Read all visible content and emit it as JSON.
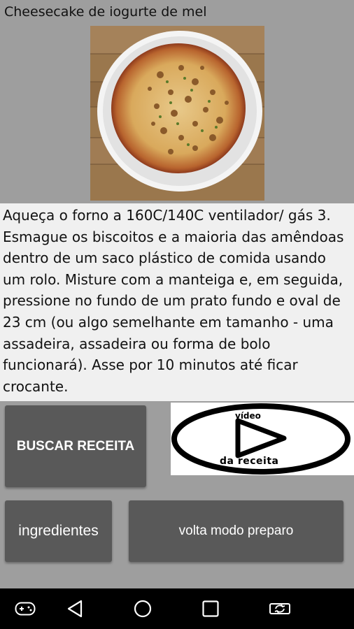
{
  "recipe": {
    "title": "Cheesecake de iogurte de mel",
    "description": "Aqueça o forno a 160C/140C ventilador/ gás 3. Esmague os biscoitos e a maioria das amêndoas dentro de um saco plástico de comida usando um rolo. Misture com a manteiga e, em seguida, pressione no fundo de um prato fundo e oval de 23 cm (ou algo semelhante em tamanho - uma assadeira, assadeira ou forma de bolo funcionará). Asse por 10 minutos até ficar crocante."
  },
  "buttons": {
    "search": "BUSCAR RECEITA",
    "ingredients": "ingredientes",
    "back_to_preparation": "volta modo preparo"
  },
  "video": {
    "top_label": "vídeo",
    "bottom_label": "da receita"
  },
  "navbar": {
    "icons": [
      "gamepad-icon",
      "back-icon",
      "home-icon",
      "recents-icon",
      "screen-rotate-icon"
    ]
  }
}
